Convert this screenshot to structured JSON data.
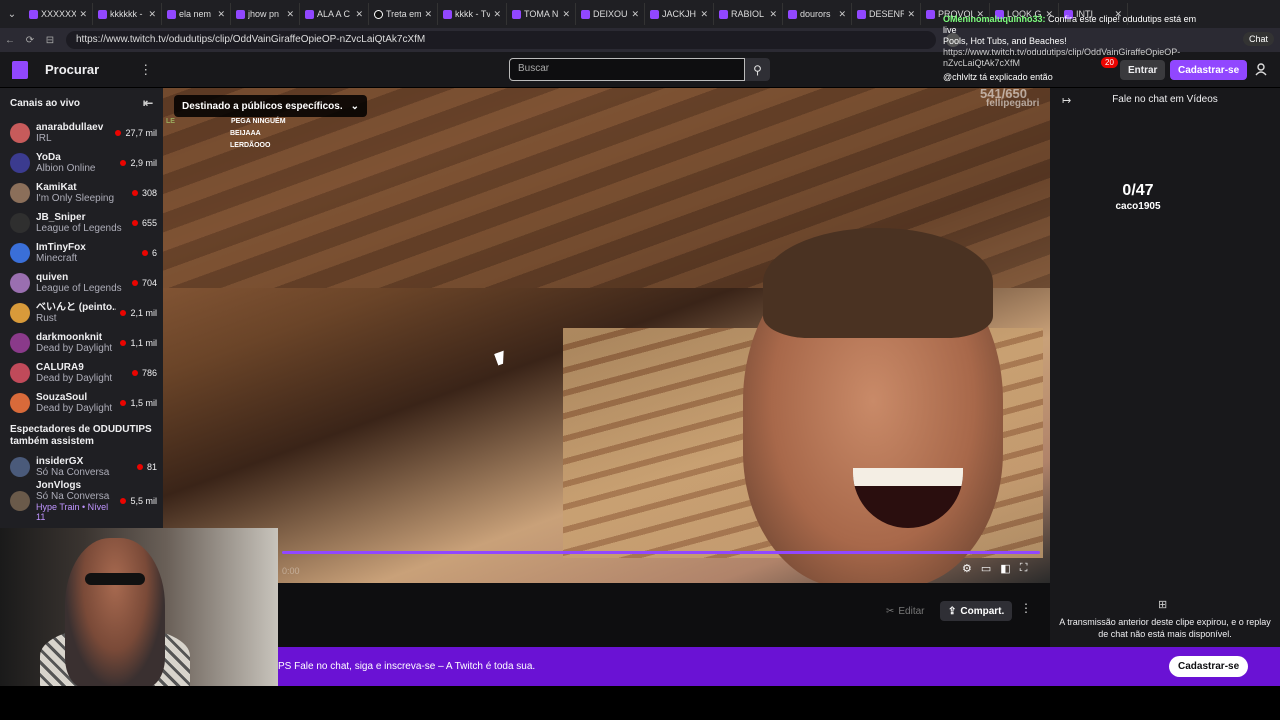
{
  "browser": {
    "tabs": [
      {
        "label": "XXXXXX",
        "favicon": "twitch-icon"
      },
      {
        "label": "kkkkkk -",
        "favicon": "twitch-icon"
      },
      {
        "label": "ela nem",
        "favicon": "twitch-icon"
      },
      {
        "label": "jhow pn",
        "favicon": "twitch-icon"
      },
      {
        "label": "ALA A C",
        "favicon": "twitch-icon"
      },
      {
        "label": "Treta em",
        "favicon": "tiktok-icon"
      },
      {
        "label": "kkkk - Tv",
        "favicon": "twitch-icon"
      },
      {
        "label": "TOMA N",
        "favicon": "twitch-icon"
      },
      {
        "label": "DEIXOU",
        "favicon": "twitch-icon"
      },
      {
        "label": "JACKJH",
        "favicon": "twitch-icon"
      },
      {
        "label": "RABIOL",
        "favicon": "twitch-icon"
      },
      {
        "label": "dourors",
        "favicon": "twitch-icon"
      },
      {
        "label": "DESENR",
        "favicon": "twitch-icon"
      },
      {
        "label": "PROVOL",
        "favicon": "twitch-icon"
      },
      {
        "label": "LOOK G",
        "favicon": "twitch-icon"
      },
      {
        "label": "INTI",
        "favicon": "twitch-icon"
      }
    ],
    "url": "https://www.twitch.tv/odudutips/clip/OddVainGiraffeOpieOP-nZvcLaiQtAk7cXfM",
    "chat_chip": "Chat"
  },
  "notification": {
    "user": "OMeninomaluquinho33:",
    "line1": "Confira este clipe! odudutips está em live",
    "line2": "Pools, Hot Tubs, and Beaches!",
    "line3": "https://www.twitch.tv/odudutips/clip/OddVainGiraffeOpieOP-nZvcLaiQtAk7cXfM",
    "line4": "@chlvltz tá explicado então"
  },
  "topnav": {
    "browse": "Procurar",
    "more": "⋮",
    "search_placeholder": "Buscar",
    "notify_count": "20",
    "login": "Entrar",
    "signup": "Cadastrar-se"
  },
  "sidebar": {
    "title": "Canais ao vivo",
    "channels": [
      {
        "name": "anarabdullaev",
        "game": "IRL",
        "viewers": "27,7 mil",
        "color": "#c75b5b"
      },
      {
        "name": "YoDa",
        "game": "Albion Online",
        "viewers": "2,9 mil",
        "color": "#3b3b8f"
      },
      {
        "name": "KamiKat",
        "game": "I'm Only Sleeping",
        "viewers": "308",
        "color": "#8b6f5a"
      },
      {
        "name": "JB_Sniper",
        "game": "League of Legends",
        "viewers": "655",
        "color": "#2f2f2f"
      },
      {
        "name": "ImTinyFox",
        "game": "Minecraft",
        "viewers": "6",
        "color": "#3a6fd8"
      },
      {
        "name": "quiven",
        "game": "League of Legends",
        "viewers": "704",
        "color": "#9a6fb0"
      },
      {
        "name": "べいんと (peinto...",
        "game": "Rust",
        "viewers": "2,1 mil",
        "color": "#d89a3a"
      },
      {
        "name": "darkmoonknit",
        "game": "Dead by Daylight",
        "viewers": "1,1 mil",
        "color": "#8a3a8a"
      },
      {
        "name": "CALURA9",
        "game": "Dead by Daylight",
        "viewers": "786",
        "color": "#c04a5a"
      },
      {
        "name": "SouzaSoul",
        "game": "Dead by Daylight",
        "viewers": "1,5 mil",
        "color": "#d86a3a"
      }
    ],
    "also_watch_title": "Espectadores de ODUDUTIPS também assistem",
    "also_watch": [
      {
        "name": "insiderGX",
        "game": "Só Na Conversa",
        "viewers": "81",
        "color": "#4a5a7a"
      },
      {
        "name": "JonVlogs",
        "game": "Só Na Conversa",
        "viewers": "5,5 mil",
        "color": "#6a5a4a",
        "extra": "Hype Train • Nível 11"
      }
    ]
  },
  "video": {
    "content_badge": "Destinado a públicos específicos.",
    "overlay_chat": [
      {
        "name": "LE",
        "msg": "PEGA NINGUÉM"
      },
      {
        "name": "",
        "msg": "BEIJAAA"
      },
      {
        "name": "",
        "msg": "LERDÃOOO"
      }
    ],
    "counter": "541/650",
    "counter_name": "fellipegabri",
    "progress": 1.0,
    "time": "0:00"
  },
  "actions": {
    "edit": "Editar",
    "share": "Compart.",
    "more": "⋮"
  },
  "chat": {
    "header": "Fale no chat em Vídeos",
    "counter": "0/47",
    "counter_name": "caco1905",
    "expired": "A transmissão anterior deste clipe expirou, e o replay de chat não está mais disponível."
  },
  "banner": {
    "text": "PS   Fale no chat, siga e inscreva-se – A Twitch é toda sua.",
    "button": "Cadastrar-se"
  },
  "colors": {
    "accent": "#9147ff",
    "banner": "#6a12d4",
    "live": "#eb0400"
  }
}
